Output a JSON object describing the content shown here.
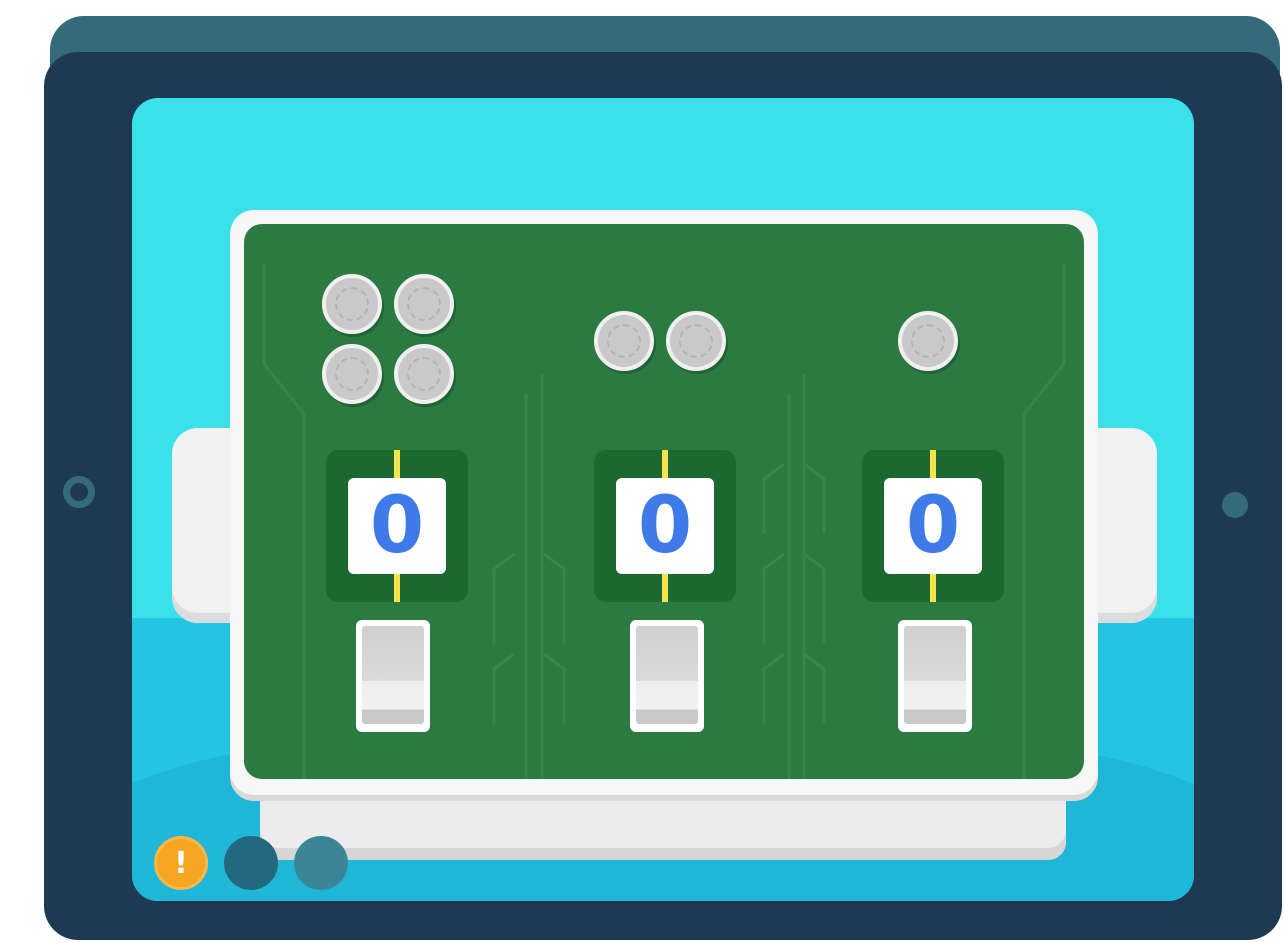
{
  "colors": {
    "tablet_bezel": "#1e3a52",
    "screen_sky": "#3ae1ea",
    "board": "#2a7a41",
    "digit": "#3f7be8",
    "progress_current": "#f5a623"
  },
  "machine": {
    "columns": [
      {
        "coins": 4,
        "counter": "0",
        "switch_state": "off"
      },
      {
        "coins": 2,
        "counter": "0",
        "switch_state": "off"
      },
      {
        "coins": 1,
        "counter": "0",
        "switch_state": "off"
      }
    ]
  },
  "progress": {
    "current_label": "!",
    "total_steps": 3,
    "current_step": 1
  }
}
